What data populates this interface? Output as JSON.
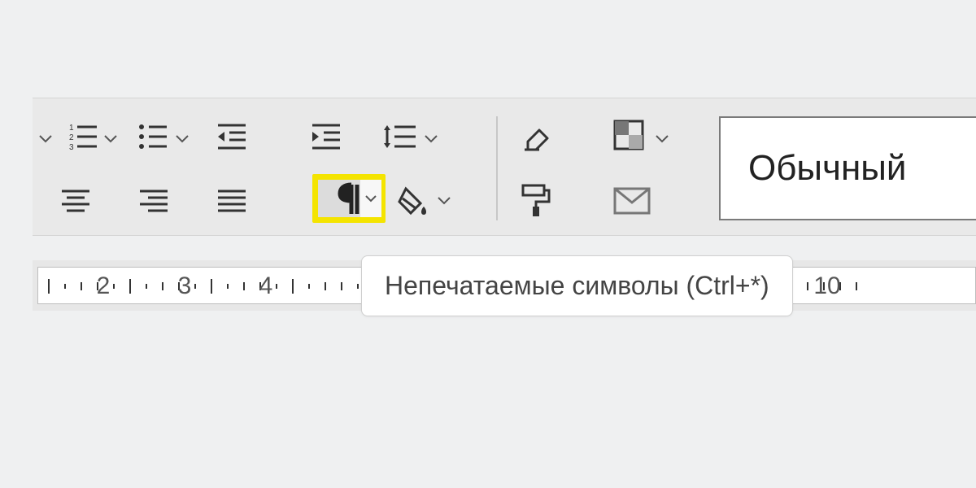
{
  "style_dropdown": {
    "current": "Обычный"
  },
  "tooltip": {
    "text": "Непечатаемые символы (Ctrl+*)"
  },
  "ruler": {
    "numbers": [
      2,
      3,
      4,
      10
    ]
  },
  "icons": {
    "numbered_list": "numbered-list-icon",
    "bulleted_list": "bulleted-list-icon",
    "decrease_indent": "decrease-indent-icon",
    "increase_indent": "increase-indent-icon",
    "line_spacing": "line-spacing-icon",
    "eraser": "eraser-icon",
    "color_swatch": "color-swatch-icon",
    "align_center": "align-center-icon",
    "align_right": "align-right-icon",
    "justify": "justify-icon",
    "pilcrow": "pilcrow-icon",
    "paint_bucket": "paint-bucket-icon",
    "format_paint": "format-paint-icon",
    "envelope": "envelope-icon"
  }
}
